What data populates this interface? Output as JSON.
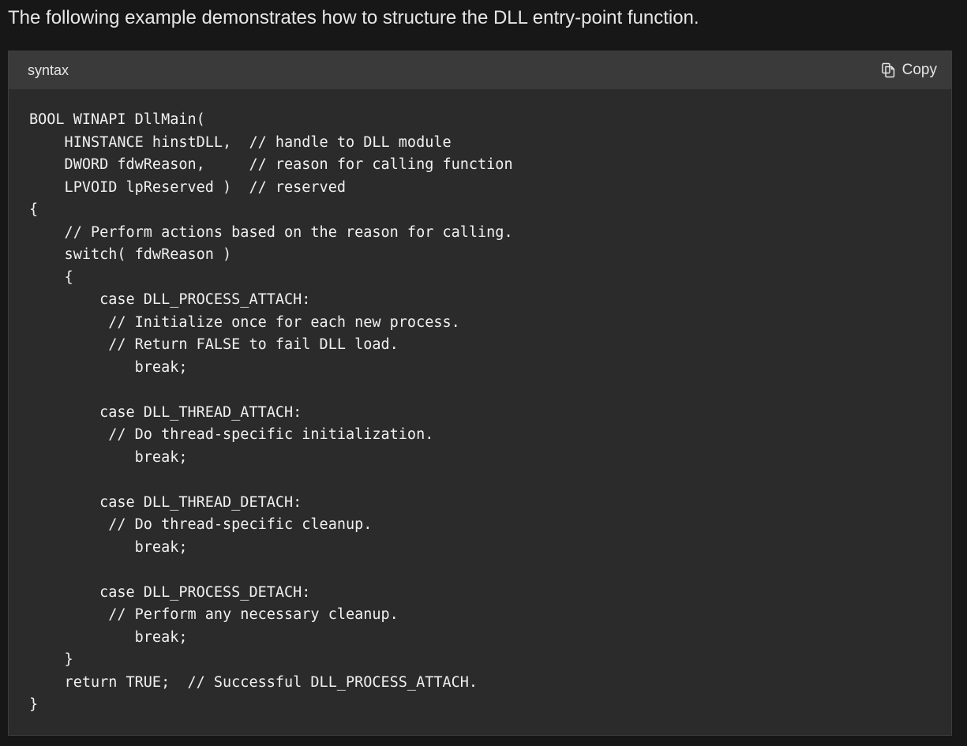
{
  "intro": {
    "text": "The following example demonstrates how to structure the DLL entry-point function."
  },
  "code_block": {
    "language_label": "syntax",
    "copy_label": "Copy",
    "copy_icon": "copy-icon",
    "lines": [
      "BOOL WINAPI DllMain(",
      "    HINSTANCE hinstDLL,  // handle to DLL module",
      "    DWORD fdwReason,     // reason for calling function",
      "    LPVOID lpReserved )  // reserved",
      "{",
      "    // Perform actions based on the reason for calling.",
      "    switch( fdwReason )",
      "    {",
      "        case DLL_PROCESS_ATTACH:",
      "         // Initialize once for each new process.",
      "         // Return FALSE to fail DLL load.",
      "            break;",
      "",
      "        case DLL_THREAD_ATTACH:",
      "         // Do thread-specific initialization.",
      "            break;",
      "",
      "        case DLL_THREAD_DETACH:",
      "         // Do thread-specific cleanup.",
      "            break;",
      "",
      "        case DLL_PROCESS_DETACH:",
      "         // Perform any necessary cleanup.",
      "            break;",
      "    }",
      "    return TRUE;  // Successful DLL_PROCESS_ATTACH.",
      "}"
    ]
  }
}
